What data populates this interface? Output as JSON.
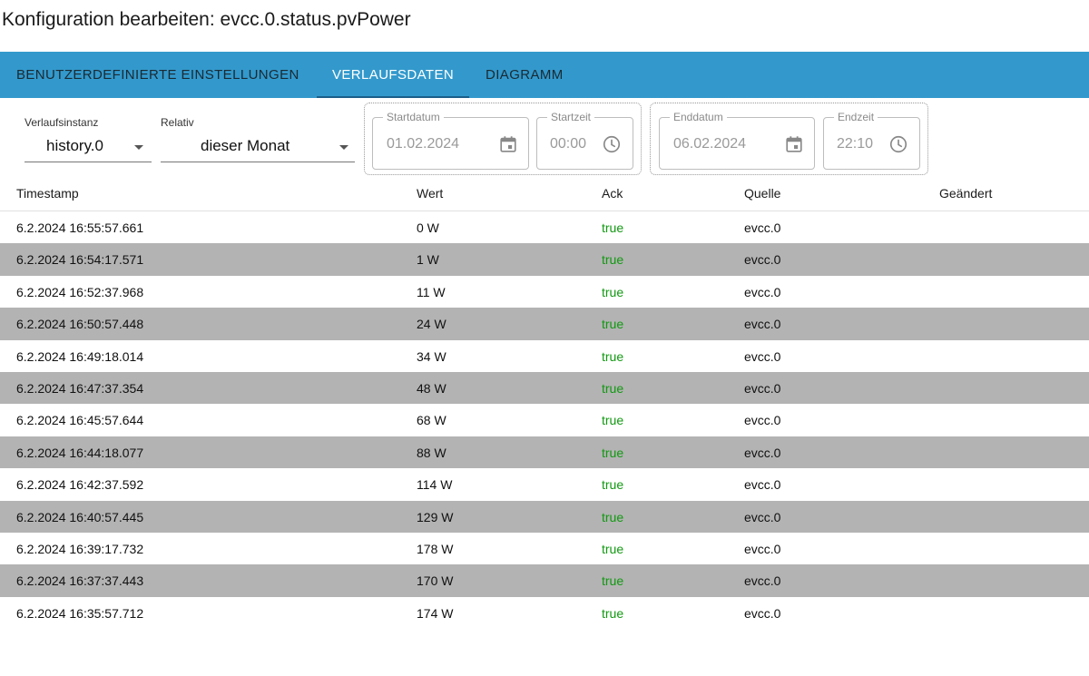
{
  "title": "Konfiguration bearbeiten: evcc.0.status.pvPower",
  "tabs": [
    {
      "label": "BENUTZERDEFINIERTE EINSTELLUNGEN"
    },
    {
      "label": "VERLAUFSDATEN"
    },
    {
      "label": "DIAGRAMM"
    }
  ],
  "active_tab": "VERLAUFSDATEN",
  "filters": {
    "instance": {
      "label": "Verlaufsinstanz",
      "value": "history.0"
    },
    "relative": {
      "label": "Relativ",
      "value": "dieser Monat"
    },
    "start_date": {
      "label": "Startdatum",
      "value": "01.02.2024"
    },
    "start_time": {
      "label": "Startzeit",
      "value": "00:00"
    },
    "end_date": {
      "label": "Enddatum",
      "value": "06.02.2024"
    },
    "end_time": {
      "label": "Endzeit",
      "value": "22:10"
    }
  },
  "icons": {
    "calendar": "calendar-icon",
    "clock": "clock-icon",
    "dropdown": "dropdown-arrow-icon"
  },
  "colors": {
    "tabbar": "#3399cc",
    "ack_true": "#119911",
    "row_alt": "#b3b3b3"
  },
  "table": {
    "columns": [
      "Timestamp",
      "Wert",
      "Ack",
      "Quelle",
      "Geändert"
    ],
    "rows": [
      {
        "timestamp": "6.2.2024 16:55:57.661",
        "value": "0 W",
        "ack": "true",
        "source": "evcc.0",
        "changed": ""
      },
      {
        "timestamp": "6.2.2024 16:54:17.571",
        "value": "1 W",
        "ack": "true",
        "source": "evcc.0",
        "changed": ""
      },
      {
        "timestamp": "6.2.2024 16:52:37.968",
        "value": "11 W",
        "ack": "true",
        "source": "evcc.0",
        "changed": ""
      },
      {
        "timestamp": "6.2.2024 16:50:57.448",
        "value": "24 W",
        "ack": "true",
        "source": "evcc.0",
        "changed": ""
      },
      {
        "timestamp": "6.2.2024 16:49:18.014",
        "value": "34 W",
        "ack": "true",
        "source": "evcc.0",
        "changed": ""
      },
      {
        "timestamp": "6.2.2024 16:47:37.354",
        "value": "48 W",
        "ack": "true",
        "source": "evcc.0",
        "changed": ""
      },
      {
        "timestamp": "6.2.2024 16:45:57.644",
        "value": "68 W",
        "ack": "true",
        "source": "evcc.0",
        "changed": ""
      },
      {
        "timestamp": "6.2.2024 16:44:18.077",
        "value": "88 W",
        "ack": "true",
        "source": "evcc.0",
        "changed": ""
      },
      {
        "timestamp": "6.2.2024 16:42:37.592",
        "value": "114 W",
        "ack": "true",
        "source": "evcc.0",
        "changed": ""
      },
      {
        "timestamp": "6.2.2024 16:40:57.445",
        "value": "129 W",
        "ack": "true",
        "source": "evcc.0",
        "changed": ""
      },
      {
        "timestamp": "6.2.2024 16:39:17.732",
        "value": "178 W",
        "ack": "true",
        "source": "evcc.0",
        "changed": ""
      },
      {
        "timestamp": "6.2.2024 16:37:37.443",
        "value": "170 W",
        "ack": "true",
        "source": "evcc.0",
        "changed": ""
      },
      {
        "timestamp": "6.2.2024 16:35:57.712",
        "value": "174 W",
        "ack": "true",
        "source": "evcc.0",
        "changed": ""
      }
    ]
  }
}
